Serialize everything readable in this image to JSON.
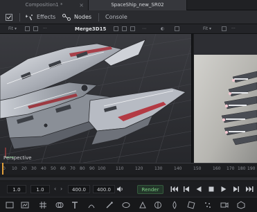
{
  "tabs": [
    {
      "label": "Composition1 *"
    },
    {
      "label": "SpaceShip_new_SR02"
    }
  ],
  "toolbar": {
    "effects_label": "Effects",
    "nodes_label": "Nodes",
    "console_label": "Console"
  },
  "viewer": {
    "fit_label": "Fit",
    "node_name": "Merge3D15",
    "right_fit_label": "Fit",
    "camera_label": "Perspective"
  },
  "timeline": {
    "ticks": [
      "0",
      "10",
      "20",
      "30",
      "40",
      "50",
      "60",
      "70",
      "80",
      "90",
      "100",
      "110",
      "120",
      "130",
      "140",
      "150",
      "160",
      "170",
      "180",
      "190"
    ]
  },
  "transport": {
    "global_start": "1.0",
    "render_start": "1.0",
    "render_end": "400.0",
    "global_end": "400.0",
    "render_label": "Render"
  },
  "colors": {
    "accent": "#e3a03a",
    "render_green": "#7dcf84"
  }
}
